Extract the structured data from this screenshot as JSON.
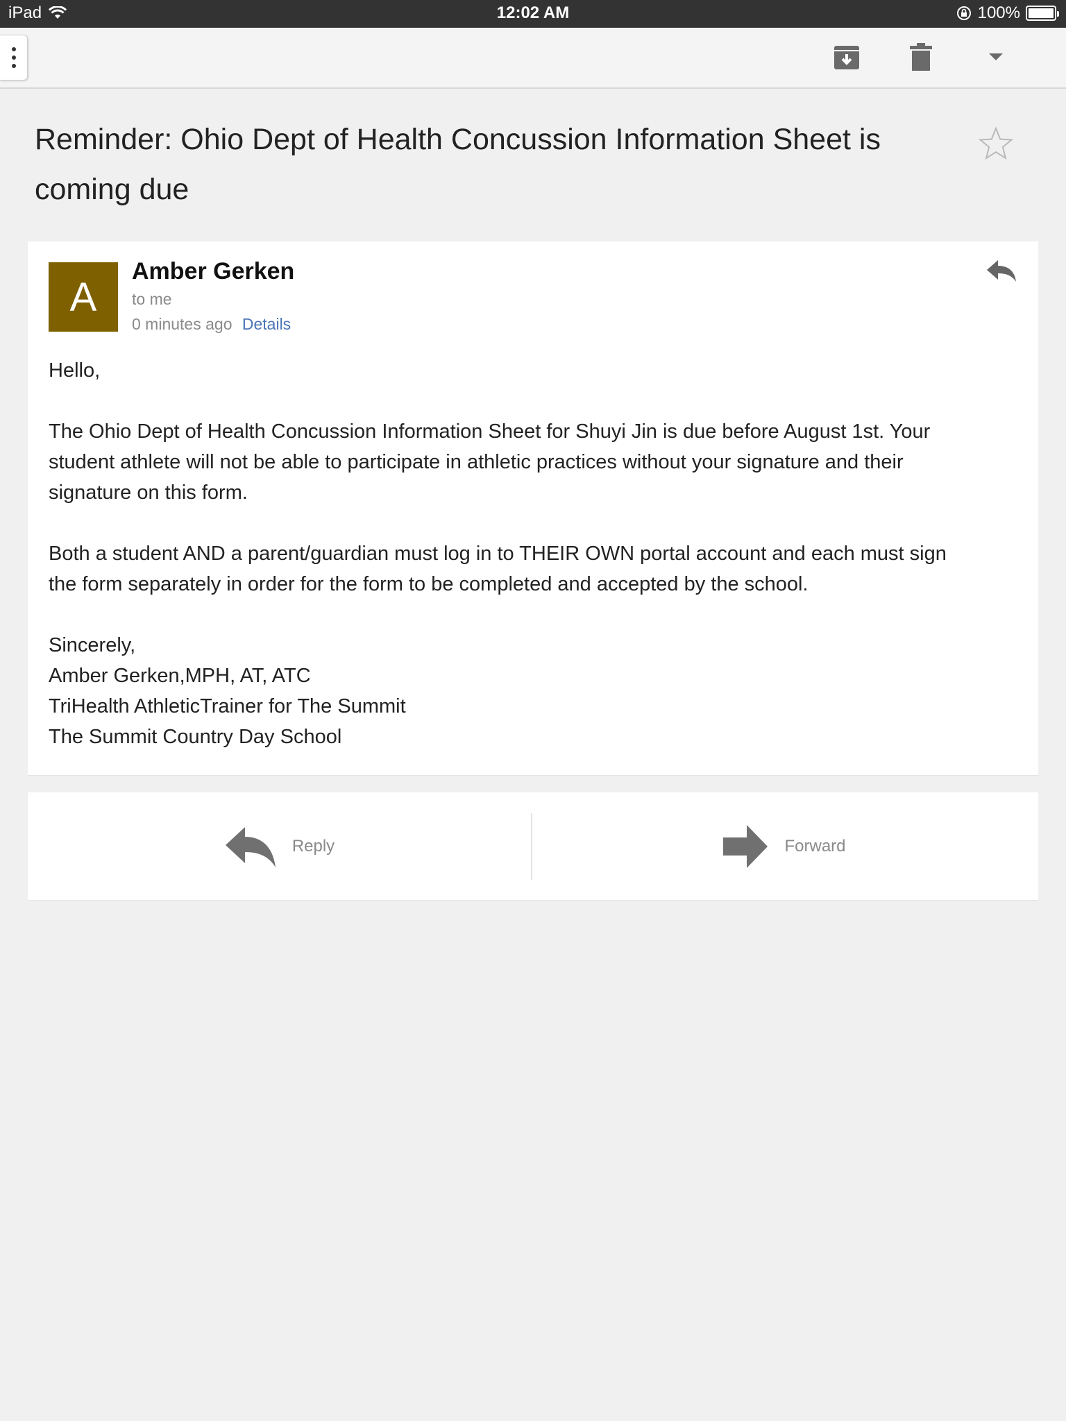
{
  "status_bar": {
    "device": "iPad",
    "time": "12:02 AM",
    "battery": "100%",
    "battery_level": 1.0
  },
  "toolbar": {
    "menu_icon": "more-vertical-icon",
    "archive_icon": "archive-icon",
    "delete_icon": "trash-icon",
    "more_icon": "caret-down-icon"
  },
  "email": {
    "subject_line1": "Reminder: Ohio Dept of Health Concussion Information Sheet is",
    "subject_line2": "coming due",
    "sender_name": "Amber Gerken",
    "sender_initial": "A",
    "avatar_color": "#7f6000",
    "recipient": "to me",
    "time": "0 minutes ago",
    "details_link": "Details",
    "body": {
      "greeting": "Hello,",
      "paragraph1_line1": "The Ohio Dept of Health Concussion Information Sheet for Shuyi Jin is due before August 1st. Your",
      "paragraph1_line2": "student athlete will not be able to participate in athletic practices without your signature and their",
      "paragraph1_line3": "signature on this form.",
      "paragraph2_line1": "Both a student AND a parent/guardian must log in to THEIR OWN portal account and each must sign",
      "paragraph2_line2": "the form separately in order for the form to be completed and accepted by the school.",
      "closing": "Sincerely,",
      "signature_name": "Amber Gerken,MPH, AT, ATC",
      "signature_title": "TriHealth AthleticTrainer for The Summit",
      "signature_org": "The Summit Country Day School"
    }
  },
  "actions": {
    "reply_label": "Reply",
    "forward_label": "Forward"
  },
  "colors": {
    "link": "#4a74b8",
    "icon_gray": "#777777",
    "background": "#f0f0f0"
  }
}
